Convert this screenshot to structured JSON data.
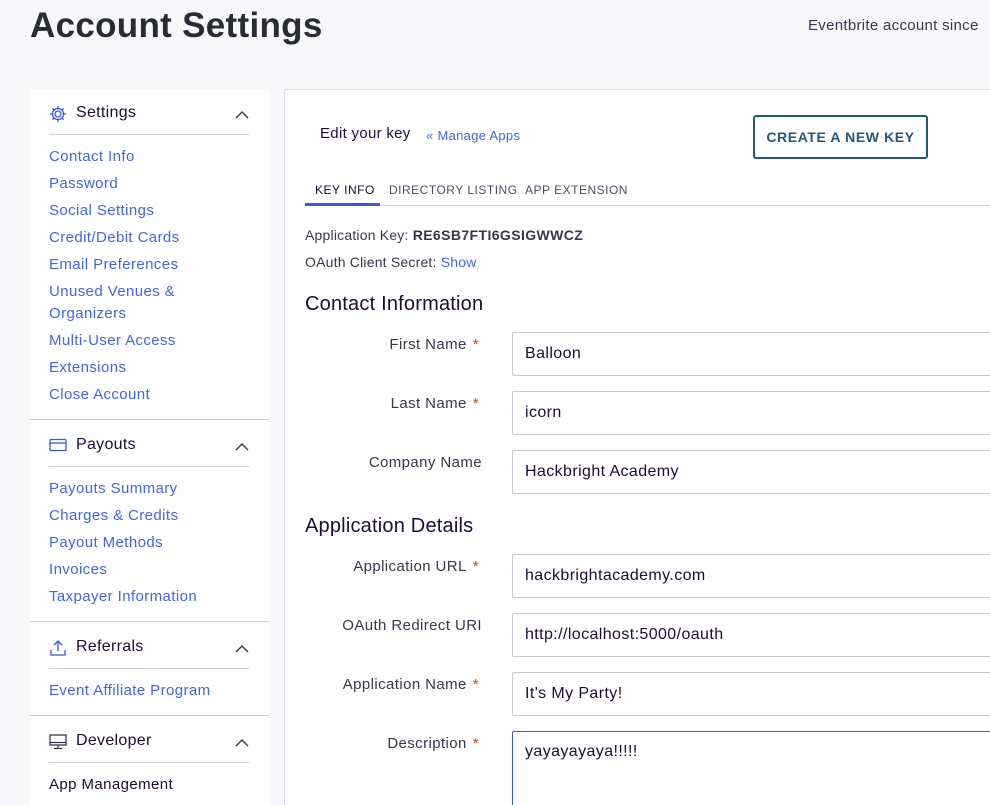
{
  "header": {
    "title": "Account Settings",
    "account_since": "Eventbrite account since"
  },
  "sidebar": {
    "sections": [
      {
        "title": "Settings",
        "icon": "gear-icon",
        "items": [
          "Contact Info",
          "Password",
          "Social Settings",
          "Credit/Debit Cards",
          "Email Preferences",
          "Unused Venues & Organizers",
          "Multi-User Access",
          "Extensions",
          "Close Account"
        ]
      },
      {
        "title": "Payouts",
        "icon": "card-icon",
        "items": [
          "Payouts Summary",
          "Charges & Credits",
          "Payout Methods",
          "Invoices",
          "Taxpayer Information"
        ]
      },
      {
        "title": "Referrals",
        "icon": "share-icon",
        "items": [
          "Event Affiliate Program"
        ]
      },
      {
        "title": "Developer",
        "icon": "monitor-icon",
        "items": [
          "App Management"
        ]
      }
    ]
  },
  "main": {
    "edit_key_label": "Edit your key",
    "manage_apps_link": "« Manage Apps",
    "create_key_button": "CREATE A NEW KEY",
    "tabs": [
      "KEY INFO",
      "DIRECTORY LISTING",
      "APP EXTENSION"
    ],
    "active_tab": "KEY INFO",
    "application_key_label": "Application Key:",
    "application_key_value": "RE6SB7FTI6GSIGWWCZ",
    "oauth_secret_label": "OAuth Client Secret:",
    "oauth_secret_action": "Show",
    "contact_section_title": "Contact Information",
    "app_section_title": "Application Details",
    "fields": {
      "first_name": {
        "label": "First Name",
        "value": "Balloon",
        "required": true
      },
      "last_name": {
        "label": "Last Name",
        "value": "icorn",
        "required": true
      },
      "company_name": {
        "label": "Company Name",
        "value": "Hackbright Academy",
        "required": false
      },
      "application_url": {
        "label": "Application URL",
        "value": "hackbrightacademy.com",
        "required": true
      },
      "oauth_redirect_uri": {
        "label": "OAuth Redirect URI",
        "value": "http://localhost:5000/oauth",
        "required": false
      },
      "application_name": {
        "label": "Application Name",
        "value": "It's My Party!",
        "required": true
      },
      "description": {
        "label": "Description",
        "value": "yayayayaya!!!!!",
        "required": true
      }
    },
    "required_marker": "*"
  },
  "colors": {
    "accent": "#3d64ff",
    "button_border": "#1e5a7a",
    "required": "#d1410c",
    "text": "#1e0a3c"
  }
}
